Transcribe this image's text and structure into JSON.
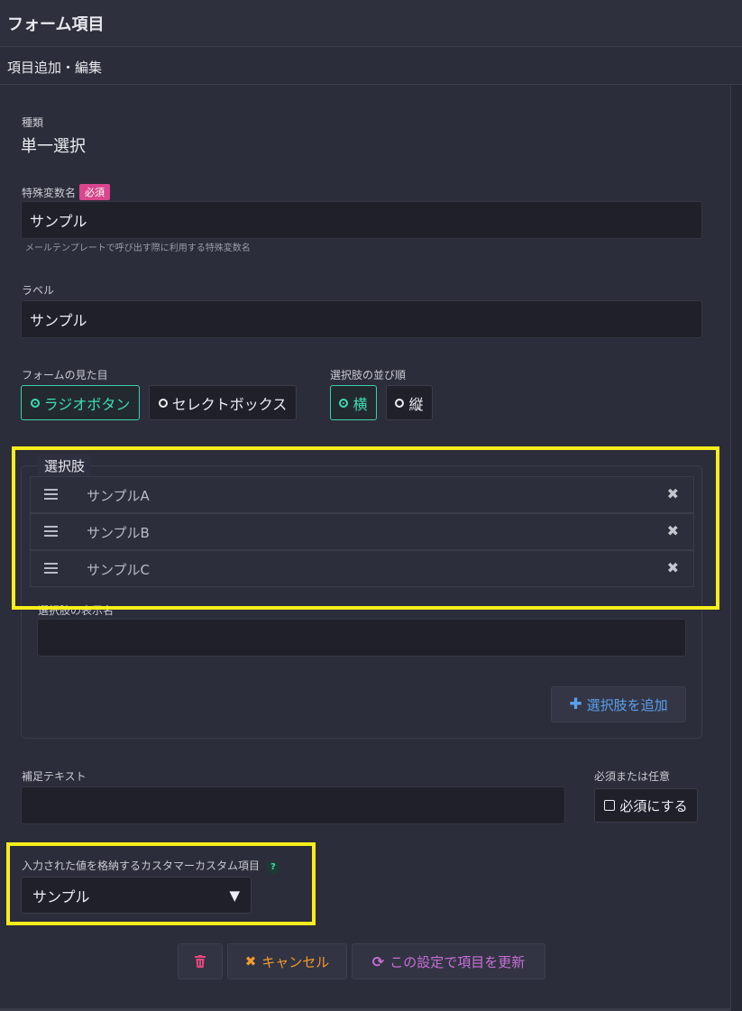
{
  "header": {
    "title": "フォーム項目"
  },
  "subheader": {
    "title": "項目追加・編集"
  },
  "type_field": {
    "label": "種類",
    "value": "単一選択"
  },
  "variable_field": {
    "label": "特殊変数名",
    "required_badge": "必須",
    "value": "サンプル",
    "hint": "メールテンプレートで呼び出す際に利用する特殊変数名"
  },
  "label_field": {
    "label": "ラベル",
    "value": "サンプル"
  },
  "appearance": {
    "label": "フォームの見た目",
    "options": [
      "ラジオボタン",
      "セレクトボックス"
    ],
    "selected": "ラジオボタン"
  },
  "order": {
    "label": "選択肢の並び順",
    "options": [
      "横",
      "縦"
    ],
    "selected": "横"
  },
  "choices": {
    "legend": "選択肢",
    "items": [
      "サンプルA",
      "サンプルB",
      "サンプルC"
    ],
    "display_name_label": "選択肢の表示名",
    "display_name_value": "",
    "add_button": "選択肢を追加"
  },
  "supplement": {
    "label": "補足テキスト",
    "value": ""
  },
  "required": {
    "label": "必須または任意",
    "checkbox_label": "必須にする",
    "checked": false
  },
  "customer_field": {
    "label": "入力された値を格納するカスタマーカスタム項目",
    "help_icon": "?",
    "selected": "サンプル"
  },
  "actions": {
    "cancel": "キャンセル",
    "update": "この設定で項目を更新"
  },
  "colors": {
    "accent_green": "#3fdcb0",
    "required_pink": "#d9468d",
    "highlight_yellow": "#f6ed1a",
    "add_blue": "#5aa0f0",
    "cancel_orange": "#f29a2e",
    "update_purple": "#c86fd8",
    "delete_red": "#e2477a"
  }
}
